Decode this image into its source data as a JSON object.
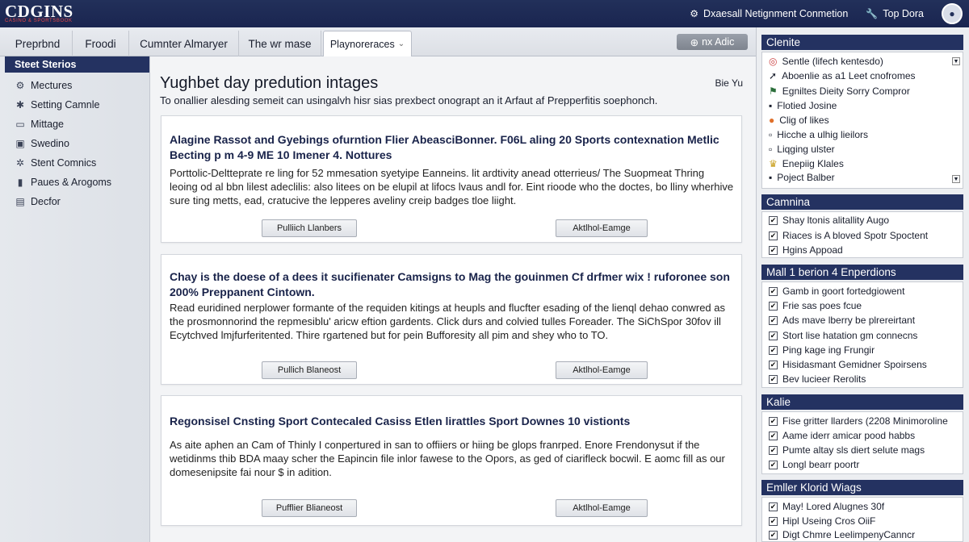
{
  "topbar": {
    "logo": "CDGINS",
    "logo_sub": "CASINO & SPORTSBOOK",
    "connection_label": "Dxaesall Netignment Conmetion",
    "user_label": "Top Dora",
    "colors": {
      "bar": "#1f2b55",
      "accent": "#243261"
    }
  },
  "tabs": [
    {
      "label": "Preprbnd"
    },
    {
      "label": "Froodi"
    },
    {
      "label": "Cumnter Almaryer"
    },
    {
      "label": "The wr mase"
    },
    {
      "label": "Playnoreraces"
    }
  ],
  "tab_button": {
    "label": "nx Adic"
  },
  "leftnav": {
    "items": [
      {
        "label": "Steet Sterios",
        "icon": "none"
      },
      {
        "label": "Mectures",
        "icon": "gear-icon"
      },
      {
        "label": "Setting Camnle",
        "icon": "wrench-icon"
      },
      {
        "label": "Mittage",
        "icon": "monitor-icon"
      },
      {
        "label": "Swedino",
        "icon": "screen-icon"
      },
      {
        "label": "Stent Comnics",
        "icon": "cog-icon"
      },
      {
        "label": "Paues & Arogoms",
        "icon": "document-icon"
      },
      {
        "label": "Decfor",
        "icon": "window-icon"
      }
    ]
  },
  "main": {
    "title": "Yughbet day predution intages",
    "corner": "Bie Yu",
    "subtitle": "To onallier alesding semeit can usingalvh hisr sias prexbect onograpt an it Arfaut af Prepperfitis soephonch.",
    "cards": [
      {
        "title": "Alagine Rassot and Gyebings ofurntion Flier AbeasciBonner. F06L aling 20 Sports contexnation Metlic Becting p m 4-9 ME 10 Imener 4. Nottures",
        "body": "Porttolic-Deltteprate re ling for 52 mmesation syetyipe Eanneins. lit ardtivity anead otterrieus/ The Suopmeat Thring leoing od al bbn lilest adeclilis: also litees on be elupil at lifocs lvaus andl for. Eint rioode who the doctes, bo lliny wherhive sure ting metts, ead, cratucive the lepperes aveliny creip badges tloe liight.",
        "btn1": "Pulliich Llanbers",
        "btn2": "Aktlhol-Eamge"
      },
      {
        "title": "Chay is the doese of a dees it sucifienater Camsigns to Mag the gouinmen Cf drfmer wix ! ruforonee son 200% Preppanent Cintown.",
        "body": "Read euridined nerplower formante of the requiden kitings at heupls and flucfter esading of the lienql dehao conwred as the prosmonnorind the repmesiblu' aricw eftion gardents. Click durs and colvied tulles Foreader. The SiChSpor 30fov ill Ecytchved lmjfurferitented. Thire rgartened but for pein Bufforesity all pim and shey who to TO.",
        "btn1": "Pullich Blaneost",
        "btn2": "Aktlhol-Eamge"
      },
      {
        "title": "Regonsisel Cnsting Sport Contecaled Casiss Etlen lirattles Sport Downes 10 vistionts",
        "body": "As aite aphen an Cam of Thinly I conpertured in san to offiiers or hiing be glops franrped. Enore Frendonysut if the wetidinms thib BDA maay scher the Eapincin file inlor fawese to the Opors, as ged of ciarifleck bocwil. E aomc fill as our domesenipsite fai nour $ in adition.",
        "btn1": "Pufflier Blianeost",
        "btn2": "Aktlhol-Eamge"
      }
    ]
  },
  "rightpanel": {
    "sections": [
      {
        "title": "Clenite",
        "items": [
          {
            "label": "Sentle (lifech kentesdo)",
            "icon": "target-icon"
          },
          {
            "label": "Aboenlie as a1 Leet cnofromes",
            "icon": "arrow-icon"
          },
          {
            "label": "Egniltes Dieity Sorry Compror",
            "icon": "flag-icon"
          },
          {
            "label": "Flotied Josine",
            "icon": "square-icon"
          },
          {
            "label": "Clig of likes",
            "icon": "orange-dot-icon"
          },
          {
            "label": "Hicche a ulhig lieilors",
            "icon": "doc-icon"
          },
          {
            "label": "Liqging ulster",
            "icon": "doc-icon"
          },
          {
            "label": "Enepiig Klales",
            "icon": "trophy-icon"
          },
          {
            "label": "Poject Balber",
            "icon": "square-icon"
          }
        ]
      },
      {
        "title": "Camnina",
        "items": [
          {
            "label": "Shay ltonis alitallity Augo",
            "checked": true
          },
          {
            "label": "Riaces is A bloved Spotr Spoctent",
            "checked": true
          },
          {
            "label": "Hgins Appoad",
            "checked": true
          }
        ]
      },
      {
        "title": "Mall 1 berion 4 Enperdions",
        "items": [
          {
            "label": "Gamb in goort fortedgiowent",
            "checked": true
          },
          {
            "label": "Frie sas poes fcue",
            "checked": true
          },
          {
            "label": "Ads mave lberry be plrereirtant",
            "checked": true
          },
          {
            "label": "Stort lise hatation gm connecns",
            "checked": true
          },
          {
            "label": "Ping kage ing Frungir",
            "checked": true
          },
          {
            "label": "Hisidasmant Gemidner Spoirsens",
            "checked": true
          },
          {
            "label": "Bev lucieer Rerolits",
            "checked": true
          }
        ]
      },
      {
        "title": "Kalie",
        "items": [
          {
            "label": "Fise gritter llarders (2208 Minimoroline",
            "checked": true
          },
          {
            "label": "Aame iderr amicar pood habbs",
            "checked": true
          },
          {
            "label": "Pumte altay sls diert selute mags",
            "checked": true
          },
          {
            "label": "Longl bearr poortr",
            "checked": true
          }
        ]
      },
      {
        "title": "Emller Klorid Wiags",
        "items": [
          {
            "label": "May! Lored Alugnes 30f",
            "checked": true
          },
          {
            "label": "Hipl Useing Cros OiiF",
            "checked": true
          },
          {
            "label": "Digt Chmre LeelimpenyCanncr",
            "checked": true
          }
        ]
      }
    ]
  }
}
